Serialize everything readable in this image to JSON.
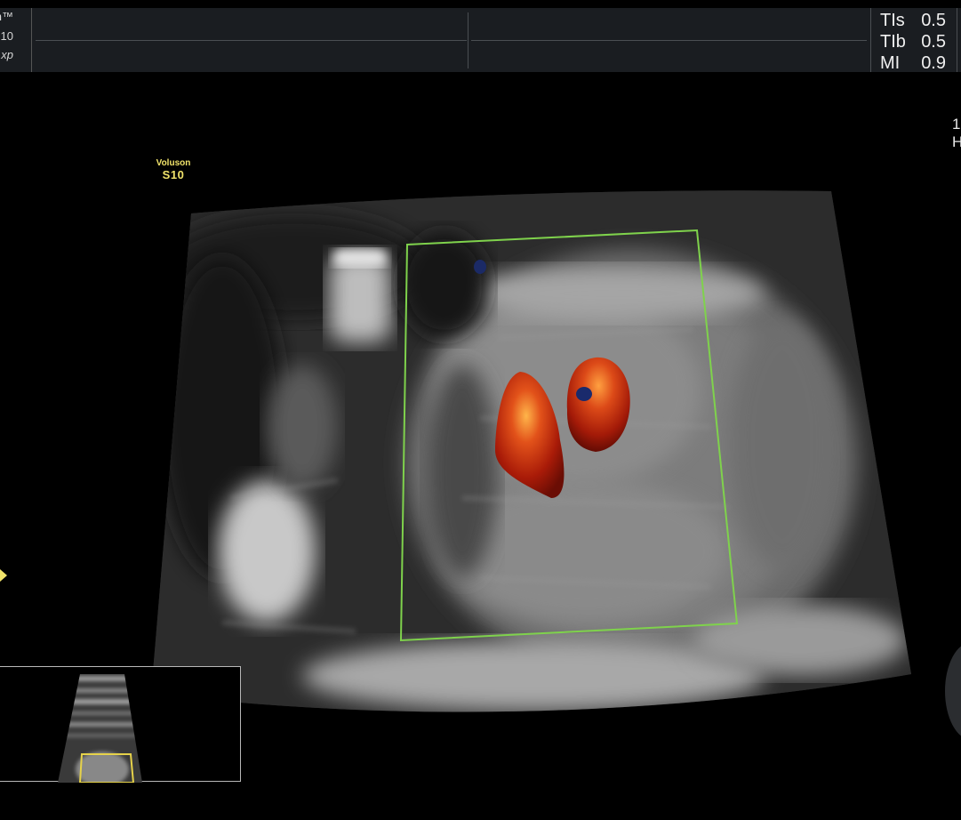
{
  "header": {
    "brand_line1": "n™",
    "brand_line2": "10",
    "brand_line3": "xp"
  },
  "acoustic_output": [
    {
      "label": "TIs",
      "value": "0.5"
    },
    {
      "label": "TIb",
      "value": "0.5"
    },
    {
      "label": "MI",
      "value": "0.9"
    }
  ],
  "edge_text": {
    "line1": "1",
    "line2": "H"
  },
  "watermark": {
    "brand": "Voluson",
    "model": "S10"
  },
  "colors": {
    "roi_box": "#7fd24c",
    "watermark": "#f1e36a",
    "doppler_hot": "#c22a0c",
    "doppler_cold": "#1a2a6c"
  },
  "icons": {
    "focus_marker": "focus-marker-icon"
  }
}
